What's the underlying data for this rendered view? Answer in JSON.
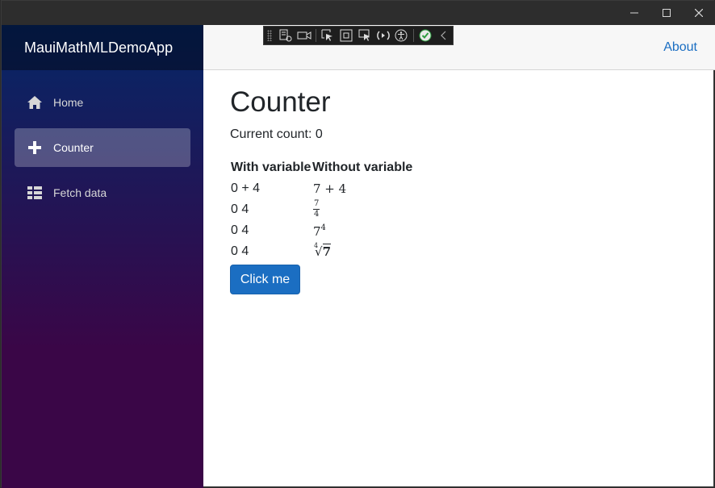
{
  "window": {
    "controls": [
      "minimize-icon",
      "maximize-icon",
      "close-icon"
    ]
  },
  "sidebar": {
    "brand": "MauiMathMLDemoApp",
    "items": [
      {
        "label": "Home",
        "icon": "home-icon",
        "active": false
      },
      {
        "label": "Counter",
        "icon": "plus-icon",
        "active": true
      },
      {
        "label": "Fetch data",
        "icon": "list-icon",
        "active": false
      }
    ]
  },
  "header": {
    "about_label": "About"
  },
  "devtools_toolbar": {
    "icons": [
      "live-visual-tree-icon",
      "record-icon",
      "select-element-icon",
      "display-adorners-icon",
      "track-focus-icon",
      "hot-reload-icon",
      "accessibility-icon",
      "status-ok-icon",
      "collapse-icon"
    ]
  },
  "main": {
    "title": "Counter",
    "current_count": "Current count: 0",
    "table": {
      "headers": [
        "With variable",
        "Without variable"
      ],
      "rows": [
        {
          "with_variable": "0 + 4",
          "without_variable": "7 + 4"
        },
        {
          "with_variable": "0 4",
          "without_variable": {
            "numerator": "7",
            "denominator": "4"
          }
        },
        {
          "with_variable": "0 4",
          "without_variable": {
            "base": "7",
            "exponent": "4"
          }
        },
        {
          "with_variable": "0 4",
          "without_variable": {
            "index": "4",
            "radicand": "7"
          }
        }
      ]
    },
    "button_label": "Click me"
  },
  "colors": {
    "accent": "#1b6ec2",
    "sidebar_top": "#052767",
    "sidebar_bottom": "#3a0647"
  }
}
